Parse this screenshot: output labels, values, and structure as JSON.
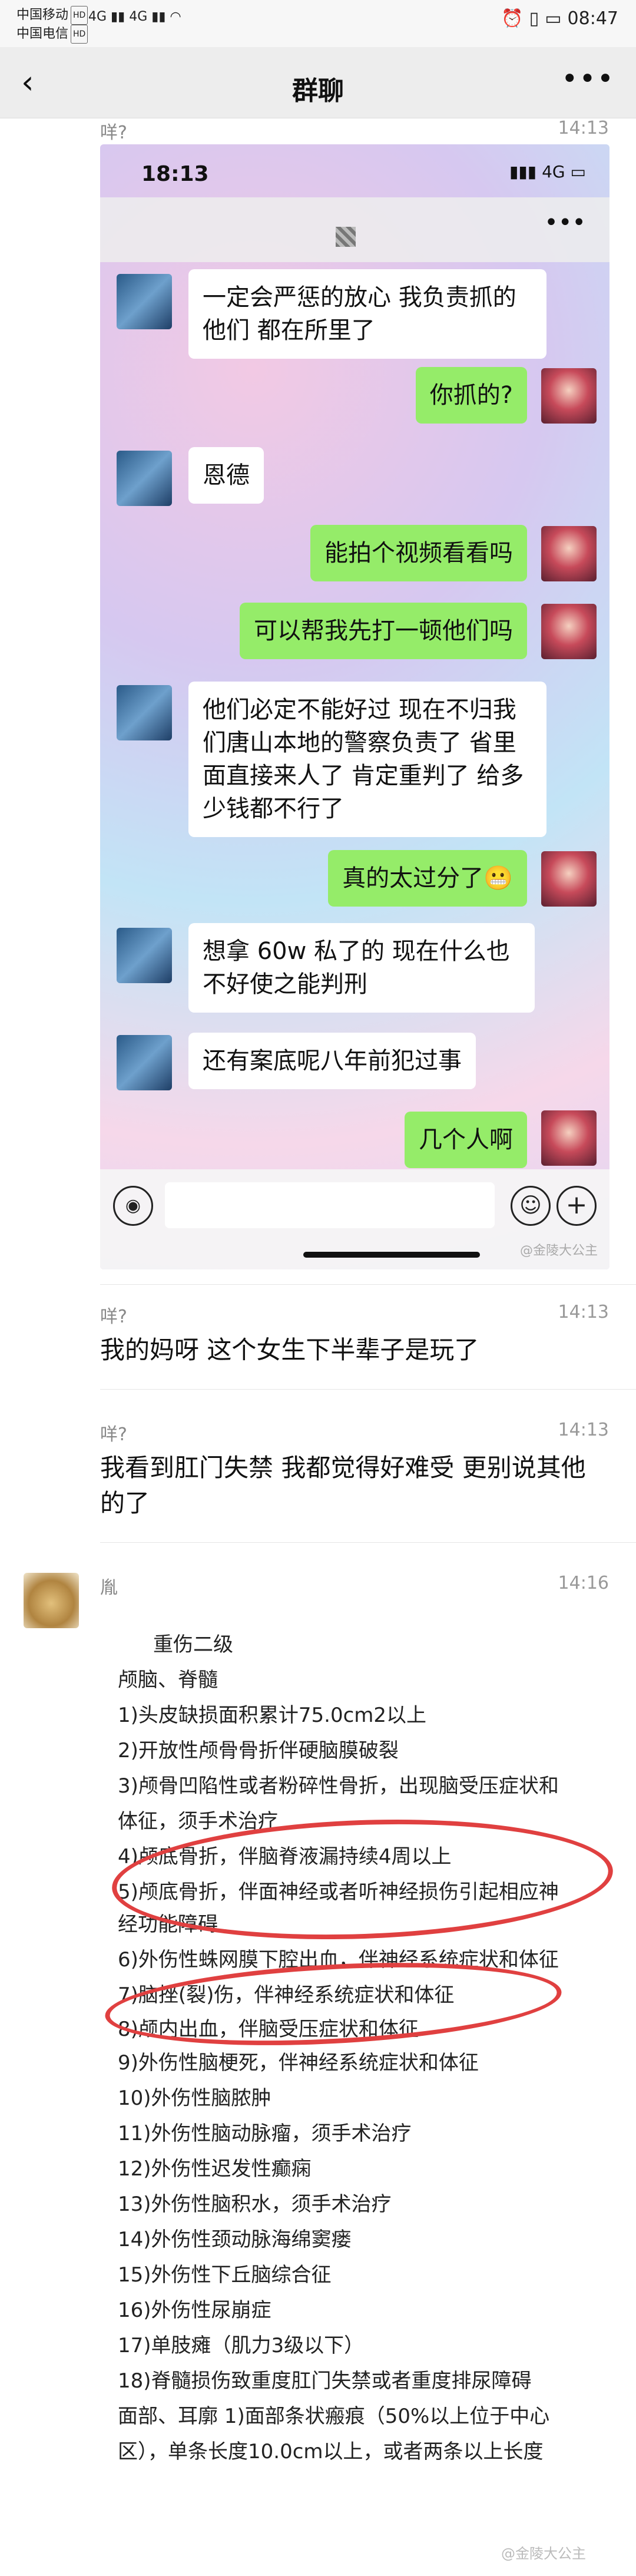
{
  "status_bar": {
    "carrier1": "中国移动",
    "carrier2": "中国电信",
    "hd_badge": "HD",
    "net1": "4G",
    "net2": "4G",
    "battery_percent": "100",
    "time": "08:47"
  },
  "nav": {
    "back_icon": "chevron-left-icon",
    "title": "群聊",
    "more_icon": "more-dots-icon"
  },
  "messages": [
    {
      "sender": "咩?",
      "time": "14:13",
      "type": "image",
      "screenshot": {
        "time": "18:13",
        "network": "4G",
        "bubbles": [
          {
            "side": "left",
            "text": "一定会严惩的放心 我负责抓的他们 都在所里了"
          },
          {
            "side": "right",
            "text": "你抓的?"
          },
          {
            "side": "left",
            "text": "恩德"
          },
          {
            "side": "right",
            "text": "能拍个视频看看吗"
          },
          {
            "side": "right",
            "text": "可以帮我先打一顿他们吗"
          },
          {
            "side": "left",
            "text": "他们必定不能好过 现在不归我们唐山本地的警察负责了 省里面直接来人了 肯定重判了 给多少钱都不行了"
          },
          {
            "side": "right",
            "text": "真的太过分了😬"
          },
          {
            "side": "left",
            "text": "想拿 60w 私了的 现在什么也不好使之能判刑"
          },
          {
            "side": "left",
            "text": "还有案底呢八年前犯过事"
          },
          {
            "side": "right",
            "text": "几个人啊"
          }
        ],
        "watermark": "@金陵大公主"
      }
    },
    {
      "sender": "咩?",
      "time": "14:13",
      "type": "text",
      "text": "我的妈呀 这个女生下半辈子是玩了"
    },
    {
      "sender": "咩?",
      "time": "14:13",
      "type": "text",
      "text": "我看到肛门失禁 我都觉得好难受 更别说其他的了"
    },
    {
      "sender": "胤",
      "time": "14:16",
      "type": "image",
      "document": {
        "lines": [
          "重伤二级",
          "颅脑、脊髓",
          "1)头皮缺损面积累计75.0cm2以上",
          "2)开放性颅骨骨折伴硬脑膜破裂",
          "3)颅骨凹陷性或者粉碎性骨折，出现脑受压症状和",
          "体征，须手术治疗",
          "4)颅底骨折，伴脑脊液漏持续4周以上",
          "5)颅底骨折，伴面神经或者听神经损伤引起相应神",
          "经功能障碍",
          "6)外伤性蛛网膜下腔出血，伴神经系统症状和体征",
          "7)脑挫(裂)伤，伴神经系统症状和体征",
          "8)颅内出血，伴脑受压症状和体征",
          "9)外伤性脑梗死，伴神经系统症状和体征",
          "10)外伤性脑脓肿",
          "11)外伤性脑动脉瘤，须手术治疗",
          "12)外伤性迟发性癫痫",
          "13)外伤性脑积水，须手术治疗",
          "14)外伤性颈动脉海绵窦瘘",
          "15)外伤性下丘脑综合征",
          "16)外伤性尿崩症",
          "17)单肢瘫（肌力3级以下）",
          "18)脊髓损伤致重度肛门失禁或者重度排尿障碍",
          "面部、耳廓 1)面部条状瘢痕（50%以上位于中心",
          "区），单条长度10.0cm以上，或者两条以上长度"
        ],
        "watermark": "@金陵大公主"
      }
    }
  ]
}
